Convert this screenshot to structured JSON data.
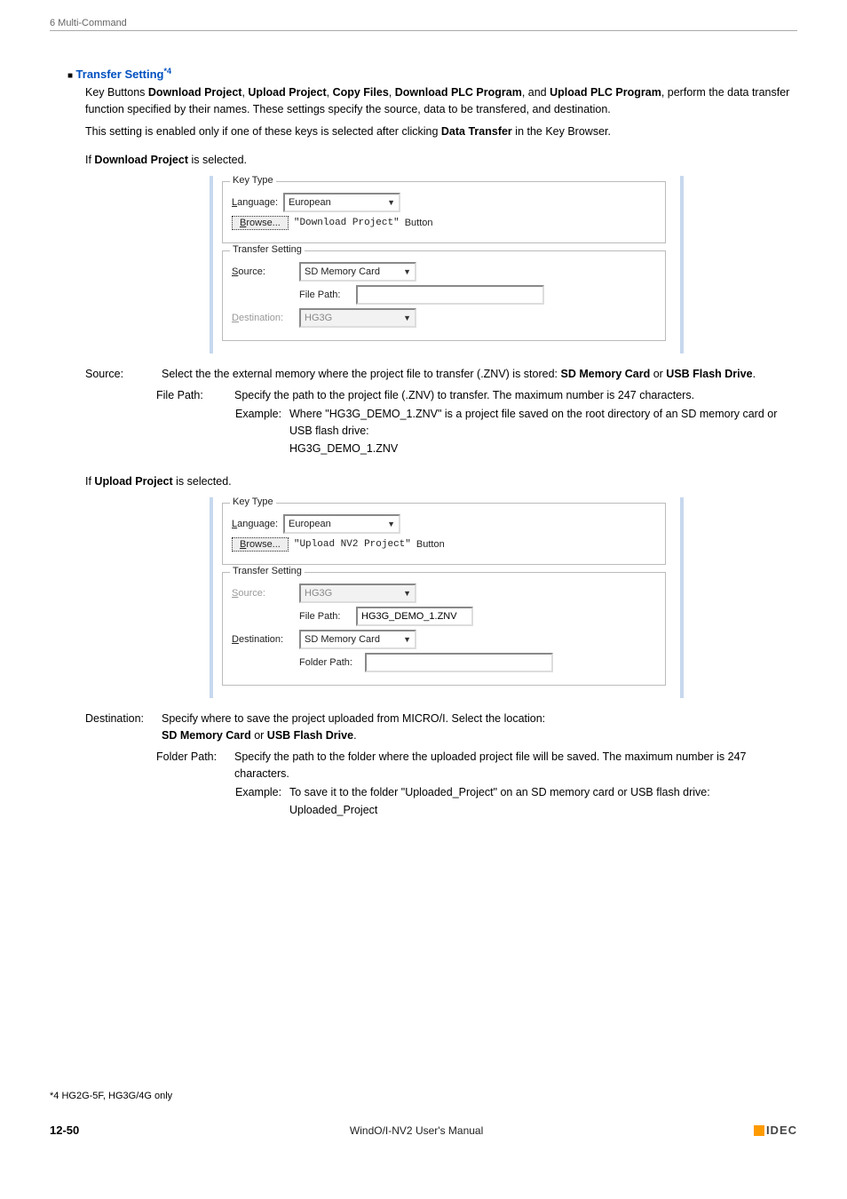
{
  "header": {
    "chapter": "6 Multi-Command"
  },
  "section": {
    "bullet": "■",
    "title": "Transfer Setting",
    "sup": "*4"
  },
  "intro": {
    "p1_pre": "Key Buttons ",
    "b1": "Download Project",
    "sep": ", ",
    "b2": "Upload Project",
    "b3": "Copy Files",
    "b4": "Download PLC Program",
    "and": ", and ",
    "b5": "Upload PLC Program",
    "p1_post": ", perform the data transfer function specified by their names. These settings specify the source, data to be transfered, and destination.",
    "p2_pre": "This setting is enabled only if one of these keys is selected after clicking ",
    "p2_b": "Data Transfer",
    "p2_post": " in the Key Browser."
  },
  "dl": {
    "if_pre": "If ",
    "if_b": "Download Project",
    "if_post": " is selected.",
    "fig": {
      "key_type": "Key Type",
      "language_lbl_u": "L",
      "language_lbl": "anguage:",
      "language_val": "European",
      "browse_u": "B",
      "browse": "rowse...",
      "button_name": "\"Download Project\"",
      "button_word": "Button",
      "transfer_setting": "Transfer Setting",
      "source_u": "S",
      "source_lbl": "ource:",
      "source_val": "SD Memory Card",
      "file_path_lbl": "File Path:",
      "file_path_val": "",
      "dest_u": "D",
      "dest_lbl": "estination:",
      "dest_val": "HG3G"
    },
    "source_term": "Source:",
    "source_body_pre": "Select the the external memory where the project file to transfer (.ZNV) is stored: ",
    "source_b1": "SD Memory Card",
    "or": " or ",
    "source_b2": "USB Flash Drive",
    "dot": ".",
    "fp_term": "File Path:",
    "fp_body": "Specify the path to the project file (.ZNV) to transfer. The maximum number is 247 characters.",
    "ex_label": "Example:",
    "ex_body": "Where \"HG3G_DEMO_1.ZNV\" is a project file saved on the root directory of an SD memory card or USB flash drive:",
    "ex_value": "HG3G_DEMO_1.ZNV"
  },
  "ul": {
    "if_pre": "If ",
    "if_b": "Upload Project",
    "if_post": " is selected.",
    "fig": {
      "key_type": "Key Type",
      "language_lbl_u": "L",
      "language_lbl": "anguage:",
      "language_val": "European",
      "browse_u": "B",
      "browse": "rowse...",
      "button_name": "\"Upload NV2 Project\"",
      "button_word": "Button",
      "transfer_setting": "Transfer Setting",
      "source_u": "S",
      "source_lbl": "ource:",
      "source_val": "HG3G",
      "file_path_lbl": "File Path:",
      "file_path_val": "HG3G_DEMO_1.ZNV",
      "dest_u": "D",
      "dest_lbl": "estination:",
      "dest_val": "SD Memory Card",
      "folder_path_lbl": "Folder Path:",
      "folder_path_val": ""
    },
    "dest_term": "Destination:",
    "dest_body_pre": "Specify where to save the project uploaded from MICRO/I. Select the location:",
    "dest_b1": "SD Memory Card",
    "or": " or ",
    "dest_b2": "USB Flash Drive",
    "dot": ".",
    "fp_term": "Folder Path:",
    "fp_body": "Specify the path to the folder where the uploaded project file will be saved. The maximum number is 247 characters.",
    "ex_label": "Example:",
    "ex_body": "To save it to the folder \"Uploaded_Project\" on an SD memory card or USB flash drive:",
    "ex_value": "Uploaded_Project"
  },
  "footnote": "*4  HG2G-5F, HG3G/4G only",
  "footer": {
    "page": "12-50",
    "center": "WindO/I-NV2 User's Manual",
    "logo": "IDEC"
  }
}
